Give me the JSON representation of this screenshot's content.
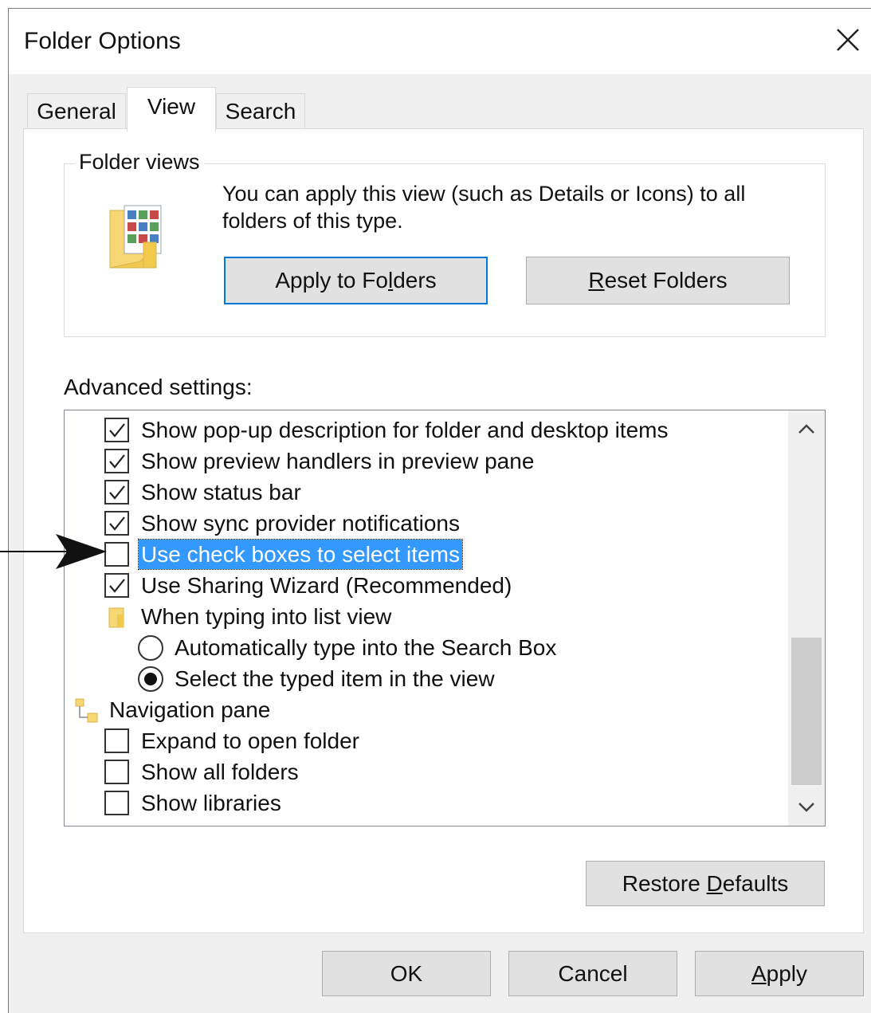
{
  "window": {
    "title": "Folder Options"
  },
  "tabs": [
    {
      "label": "General",
      "active": false
    },
    {
      "label": "View",
      "active": true
    },
    {
      "label": "Search",
      "active": false
    }
  ],
  "folder_views": {
    "legend": "Folder views",
    "description": "You can apply this view (such as Details or Icons) to all folders of this type.",
    "apply_button": {
      "text": "Apply to Fo",
      "mnemonic": "l",
      "rest": "ders"
    },
    "reset_button": {
      "text": "",
      "mnemonic": "R",
      "rest": "eset Folders"
    }
  },
  "advanced": {
    "label": "Advanced settings:",
    "items": [
      {
        "type": "checkbox",
        "checked": true,
        "label": "Show pop-up description for folder and desktop items"
      },
      {
        "type": "checkbox",
        "checked": true,
        "label": "Show preview handlers in preview pane"
      },
      {
        "type": "checkbox",
        "checked": true,
        "label": "Show status bar"
      },
      {
        "type": "checkbox",
        "checked": true,
        "label": "Show sync provider notifications"
      },
      {
        "type": "checkbox",
        "checked": false,
        "selected": true,
        "label": "Use check boxes to select items"
      },
      {
        "type": "checkbox",
        "checked": true,
        "label": "Use Sharing Wizard (Recommended)"
      },
      {
        "type": "folder-group",
        "icon": "folder-icon",
        "label": "When typing into list view"
      },
      {
        "type": "radio",
        "checked": false,
        "label": "Automatically type into the Search Box"
      },
      {
        "type": "radio",
        "checked": true,
        "label": "Select the typed item in the view"
      },
      {
        "type": "tree-group",
        "icon": "navigation-pane-icon",
        "label": "Navigation pane"
      },
      {
        "type": "checkbox",
        "checked": false,
        "label": "Expand to open folder"
      },
      {
        "type": "checkbox",
        "checked": false,
        "label": "Show all folders"
      },
      {
        "type": "checkbox",
        "checked": false,
        "label": "Show libraries"
      }
    ]
  },
  "restore_button": {
    "text": "Restore ",
    "mnemonic": "D",
    "rest": "efaults"
  },
  "footer": {
    "ok": "OK",
    "cancel": "Cancel",
    "apply": {
      "text": "",
      "mnemonic": "A",
      "rest": "pply"
    }
  },
  "colors": {
    "selection": "#3399ff",
    "default_button_border": "#0078d7",
    "dialog_bg": "#f0f0f0"
  }
}
